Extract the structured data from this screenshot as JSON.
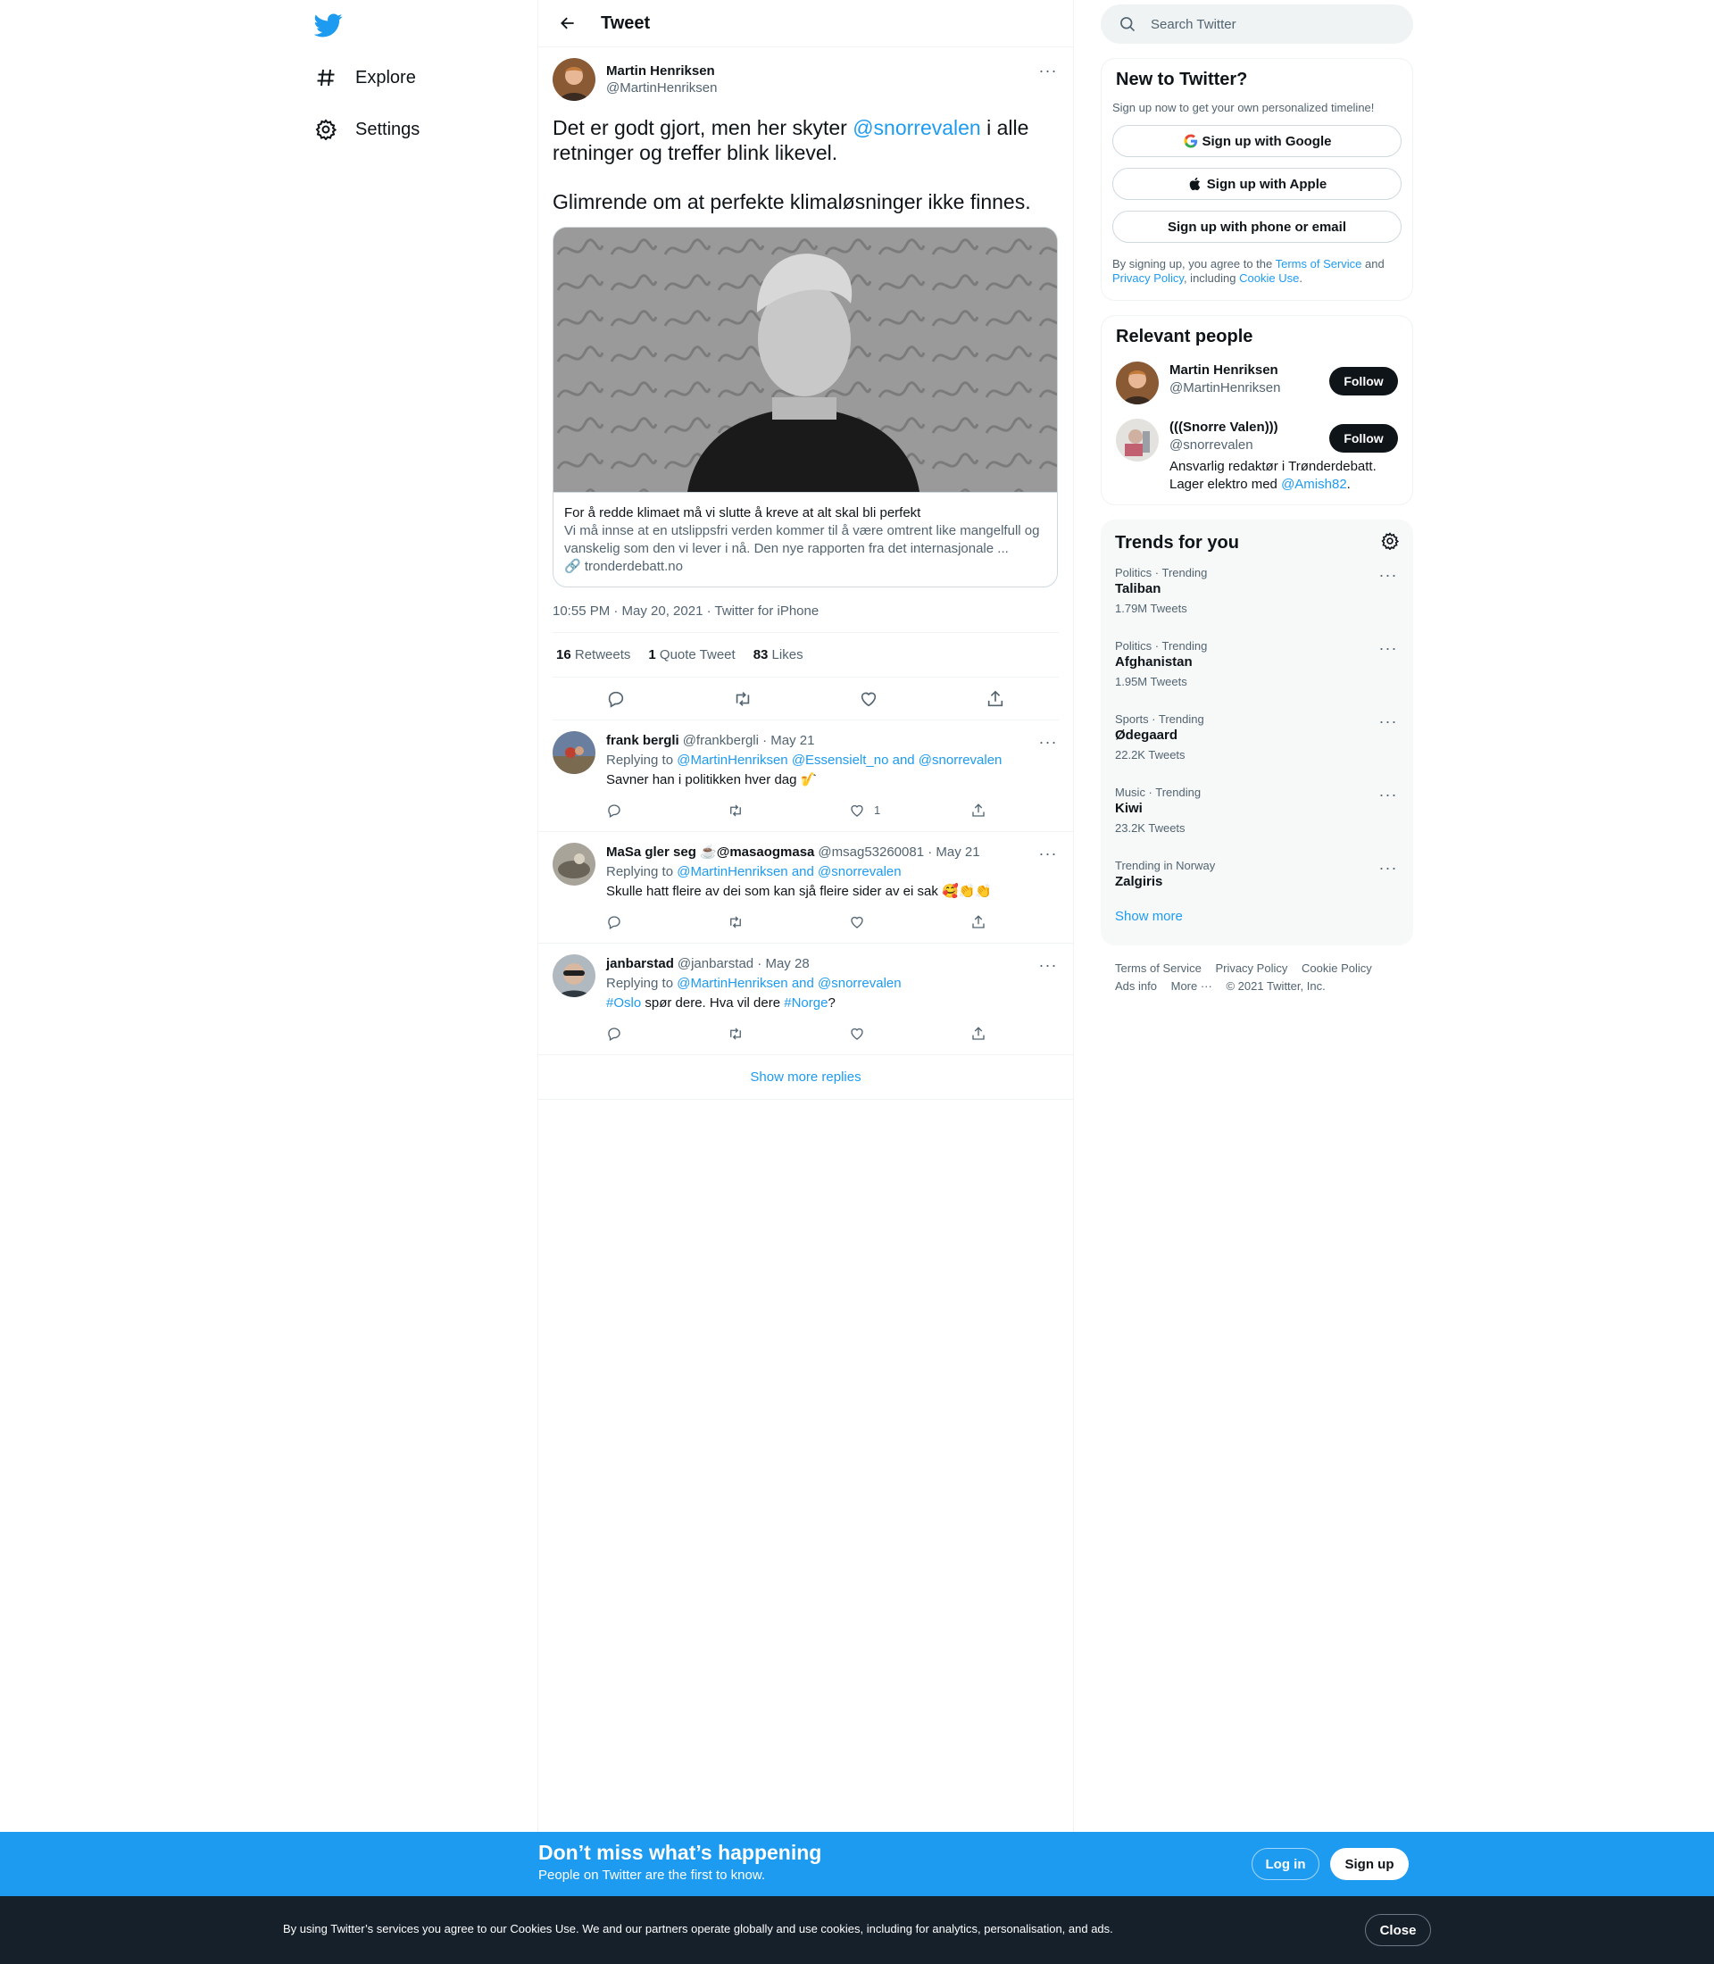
{
  "nav": {
    "items": [
      {
        "label": "Explore",
        "icon": "hashtag-icon"
      },
      {
        "label": "Settings",
        "icon": "gear-icon"
      }
    ]
  },
  "header": {
    "title": "Tweet"
  },
  "tweet": {
    "display_name": "Martin Henriksen",
    "handle": "@MartinHenriksen",
    "text_p1_a": "Det er godt gjort, men her skyter ",
    "text_p1_mention": "@snorrevalen",
    "text_p1_b": " i alle retninger og treffer blink likevel.",
    "text_p2": "Glimrende om at perfekte klimaløsninger ikke finnes.",
    "card": {
      "title": "For å redde klimaet må vi slutte å kreve at alt skal bli perfekt",
      "description": "Vi må innse at en utslippsfri verden kommer til å være omtrent like mangelfull og vanskelig som den vi lever i nå. Den nye rapporten fra det internasjonale ...",
      "domain": "tronderdebatt.no"
    },
    "meta": "10:55 PM · May 20, 2021 · Twitter for iPhone",
    "stats": {
      "retweets": "16",
      "retweets_label": "Retweets",
      "quotes": "1",
      "quotes_label": "Quote Tweet",
      "likes": "83",
      "likes_label": "Likes"
    }
  },
  "replies": [
    {
      "name": "frank bergli",
      "handle_date": "@frankbergli · May 21",
      "replying_prefix": "Replying to ",
      "replying_to": "@MartinHenriksen @Essensielt_no and @snorrevalen",
      "text": "Savner han i politikken hver dag 🎷",
      "likes": "1"
    },
    {
      "name": "MaSa gler seg ☕@masaogmasa",
      "handle_date": "@msag53260081 · May 21",
      "replying_prefix": "Replying to ",
      "replying_to": "@MartinHenriksen and @snorrevalen",
      "text": "Skulle hatt fleire av dei som kan sjå fleire sider av ei sak 🥰👏👏",
      "likes": ""
    },
    {
      "name": "janbarstad",
      "handle_date": "@janbarstad · May 28",
      "replying_prefix": "Replying to ",
      "replying_to": "@MartinHenriksen and @snorrevalen",
      "text_tag1": "#Oslo",
      "text_mid": " spør dere. Hva vil dere ",
      "text_tag2": "#Norge",
      "text_end": "?",
      "likes": ""
    }
  ],
  "show_more_replies": "Show more replies",
  "search": {
    "placeholder": "Search Twitter"
  },
  "new_to_twitter": {
    "title": "New to Twitter?",
    "subtitle": "Sign up now to get your own personalized timeline!",
    "google": "Sign up with Google",
    "apple": "Sign up with Apple",
    "phone": "Sign up with phone or email",
    "terms_a": "By signing up, you agree to the ",
    "terms_tos": "Terms of Service",
    "terms_b": " and ",
    "terms_pp": "Privacy Policy",
    "terms_c": ", including ",
    "terms_cookie": "Cookie Use",
    "terms_d": "."
  },
  "relevant": {
    "title": "Relevant people",
    "people": [
      {
        "name": "Martin Henriksen",
        "handle": "@MartinHenriksen",
        "follow": "Follow"
      },
      {
        "name": "(((Snorre Valen)))",
        "handle": "@snorrevalen",
        "follow": "Follow",
        "bio_a": "Ansvarlig redaktør i Trønderdebatt. Lager elektro med ",
        "bio_link": "@Amish82",
        "bio_b": "."
      }
    ]
  },
  "trends": {
    "title": "Trends for you",
    "items": [
      {
        "context": "Politics · Trending",
        "name": "Taliban",
        "count": "1.79M Tweets"
      },
      {
        "context": "Politics · Trending",
        "name": "Afghanistan",
        "count": "1.95M Tweets"
      },
      {
        "context": "Sports · Trending",
        "name": "Ødegaard",
        "count": "22.2K Tweets"
      },
      {
        "context": "Music · Trending",
        "name": "Kiwi",
        "count": "23.2K Tweets"
      },
      {
        "context": "Trending in Norway",
        "name": "Zalgiris",
        "count": ""
      }
    ],
    "show_more": "Show more"
  },
  "footer": {
    "links": [
      "Terms of Service",
      "Privacy Policy",
      "Cookie Policy",
      "Ads info",
      "More ···",
      "© 2021 Twitter, Inc."
    ]
  },
  "signup_bar": {
    "title": "Don’t miss what’s happening",
    "subtitle": "People on Twitter are the first to know.",
    "login": "Log in",
    "signup": "Sign up"
  },
  "cookie_bar": {
    "text": "By using Twitter’s services you agree to our Cookies Use. We and our partners operate globally and use cookies, including for analytics, personalisation, and ads.",
    "close": "Close"
  },
  "colors": {
    "accent": "#1d9bf0",
    "text": "#0f1419",
    "muted": "#536471",
    "dark": "#15202b"
  }
}
